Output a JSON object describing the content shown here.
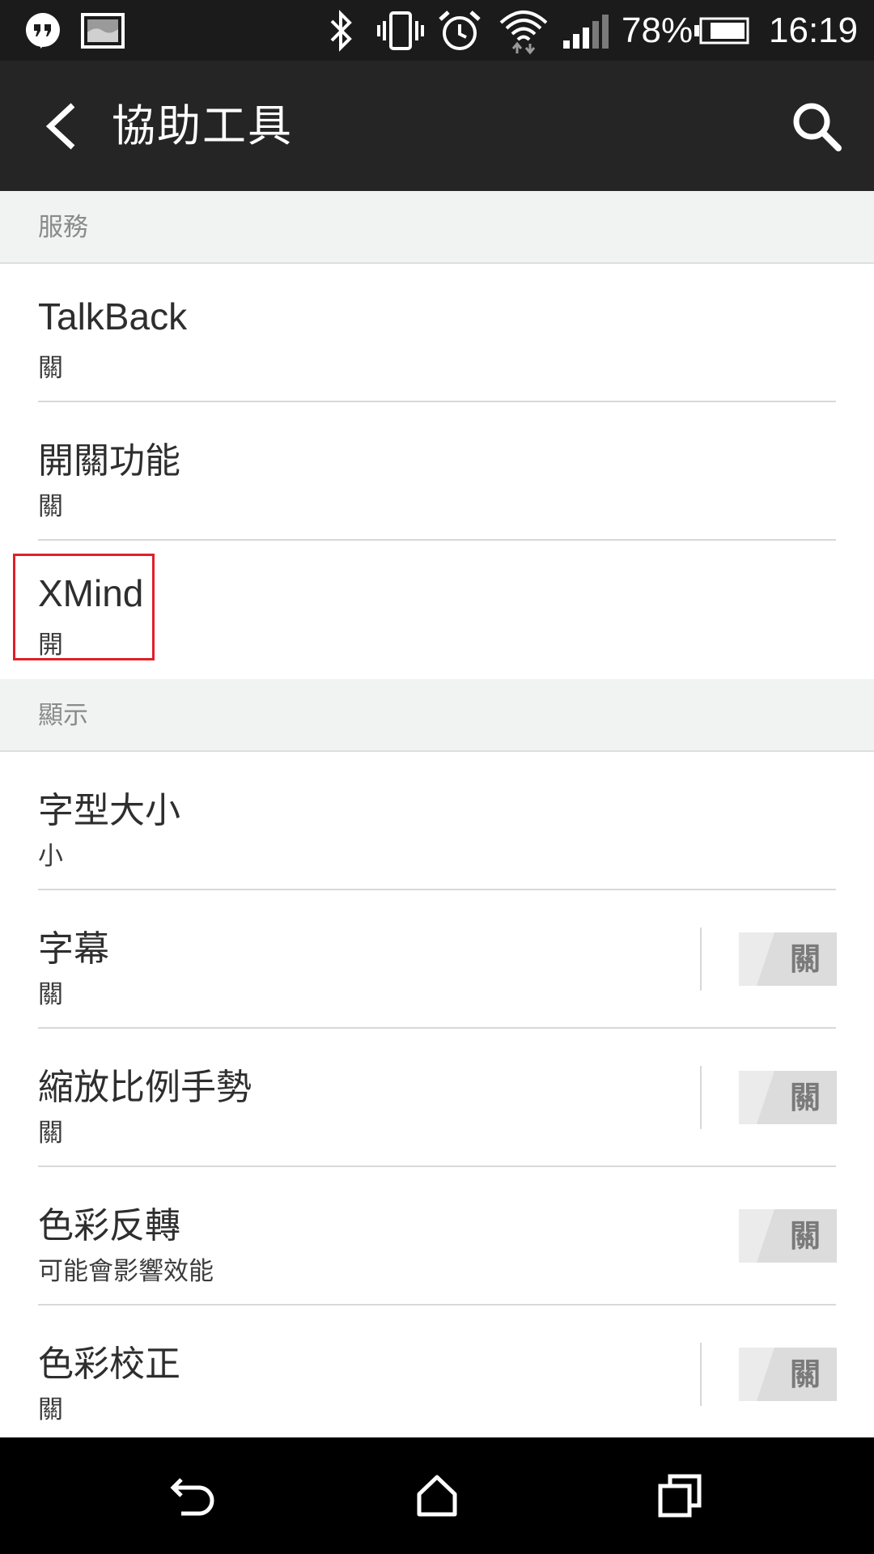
{
  "status_bar": {
    "battery_percent": "78%",
    "time": "16:19",
    "icons": [
      "hangouts-icon",
      "gallery-icon",
      "bluetooth-icon",
      "vibrate-icon",
      "alarm-icon",
      "wifi-icon",
      "signal-icon",
      "battery-icon"
    ]
  },
  "app_bar": {
    "title": "協助工具",
    "back_icon": "back-arrow-icon",
    "search_icon": "search-icon"
  },
  "sections": [
    {
      "header": "服務",
      "items": [
        {
          "title": "TalkBack",
          "subtitle": "關"
        },
        {
          "title": "開關功能",
          "subtitle": "關"
        },
        {
          "title": "XMind",
          "subtitle": "開",
          "highlighted": true
        }
      ]
    },
    {
      "header": "顯示",
      "items": [
        {
          "title": "字型大小",
          "subtitle": "小"
        },
        {
          "title": "字幕",
          "subtitle": "關",
          "toggle": "關"
        },
        {
          "title": "縮放比例手勢",
          "subtitle": "關",
          "toggle": "關"
        },
        {
          "title": "色彩反轉",
          "subtitle": "可能會影響效能",
          "toggle": "關"
        },
        {
          "title": "色彩校正",
          "subtitle": "關",
          "toggle": "關"
        }
      ]
    }
  ],
  "nav_bar": {
    "icons": [
      "back-icon",
      "home-icon",
      "recents-icon"
    ]
  },
  "colors": {
    "status_bar": "#1b1b1b",
    "app_bar": "#252525",
    "section_header_bg": "#f1f2f2",
    "highlight": "#e0202a",
    "toggle_off": "#dcdcdc"
  }
}
